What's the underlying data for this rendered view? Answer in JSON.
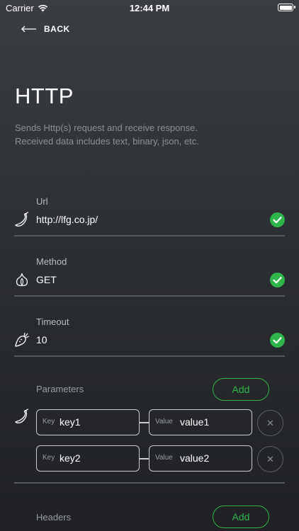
{
  "status": {
    "carrier": "Carrier",
    "time": "12:44 PM"
  },
  "nav": {
    "back_label": "BACK"
  },
  "header": {
    "title": "HTTP",
    "description_line1": "Sends Http(s) request and receive response.",
    "description_line2": "Received data includes text, binary, json, etc."
  },
  "fields": {
    "url": {
      "label": "Url",
      "value": "http://lfg.co.jp/"
    },
    "method": {
      "label": "Method",
      "value": "GET"
    },
    "timeout": {
      "label": "Timeout",
      "value": "10"
    }
  },
  "parameters": {
    "label": "Parameters",
    "add_label": "Add",
    "key_tag": "Key",
    "value_tag": "Value",
    "items": [
      {
        "key": "key1",
        "value": "value1"
      },
      {
        "key": "key2",
        "value": "value2"
      }
    ]
  },
  "headers": {
    "label": "Headers",
    "add_label": "Add"
  },
  "colors": {
    "accent": "#2fb64a",
    "background": "#2c2f33",
    "muted": "#8d9096"
  }
}
